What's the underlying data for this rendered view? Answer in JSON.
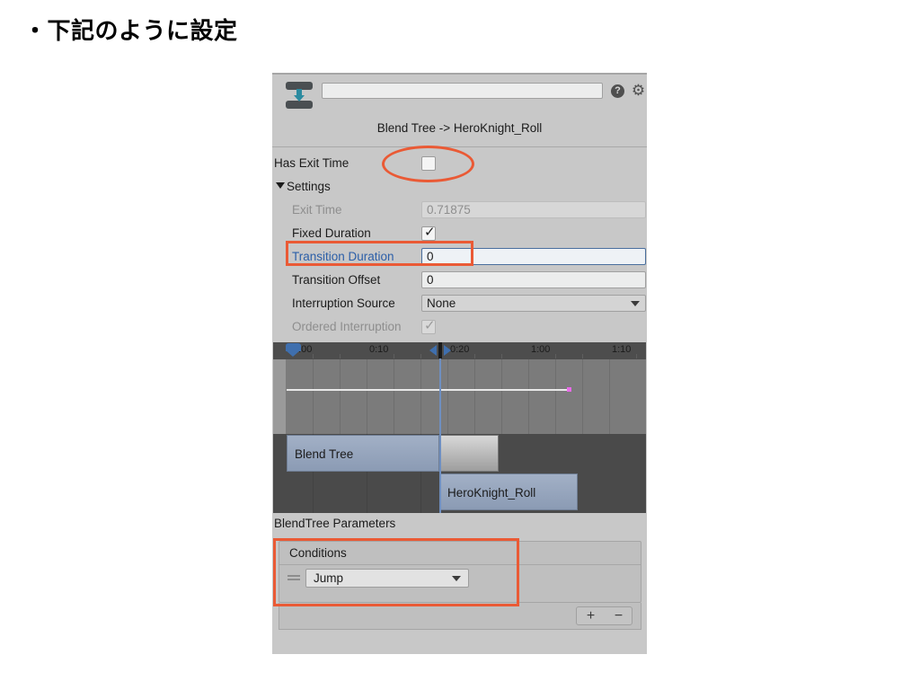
{
  "slide": {
    "title": "・下記のように設定"
  },
  "inspector": {
    "header": {
      "icon": "transition-icon",
      "name_value": "",
      "name_placeholder": "",
      "help_glyph": "?",
      "gear_glyph": "⚙"
    },
    "subtitle": "Blend Tree -> HeroKnight_Roll",
    "rows": [
      {
        "label": "Has Exit Time",
        "type": "checkbox",
        "checked": false,
        "disabled": false
      },
      {
        "label": "Settings",
        "type": "foldout",
        "expanded": true
      },
      {
        "label": "Exit Time",
        "type": "field",
        "value": "0.71875",
        "disabled": true
      },
      {
        "label": "Fixed Duration",
        "type": "checkbox",
        "checked": true,
        "disabled": false
      },
      {
        "label": "Transition Duration",
        "type": "field",
        "value": "0",
        "disabled": false,
        "highlighted": true
      },
      {
        "label": "Transition Offset",
        "type": "field",
        "value": "0",
        "disabled": false
      },
      {
        "label": "Interruption Source",
        "type": "dropdown",
        "value": "None"
      },
      {
        "label": "Ordered Interruption",
        "type": "checkbox",
        "checked": true,
        "disabled": true
      }
    ],
    "timeline": {
      "ticks": [
        "0:00",
        "0:10",
        "0:20",
        "1:00",
        "1:10"
      ],
      "clips": [
        {
          "name": "Blend Tree"
        },
        {
          "name": "HeroKnight_Roll"
        }
      ]
    },
    "blendtree_parameters_label": "BlendTree Parameters",
    "conditions": {
      "header": "Conditions",
      "rows": [
        {
          "parameter": "Jump"
        }
      ],
      "add_label": "+",
      "remove_label": "−"
    }
  },
  "colors": {
    "annotation": "#ea5a35",
    "panel_bg": "#c8c8c8",
    "highlight_label": "#2c5fa8",
    "clip": "#8b9bb4"
  }
}
